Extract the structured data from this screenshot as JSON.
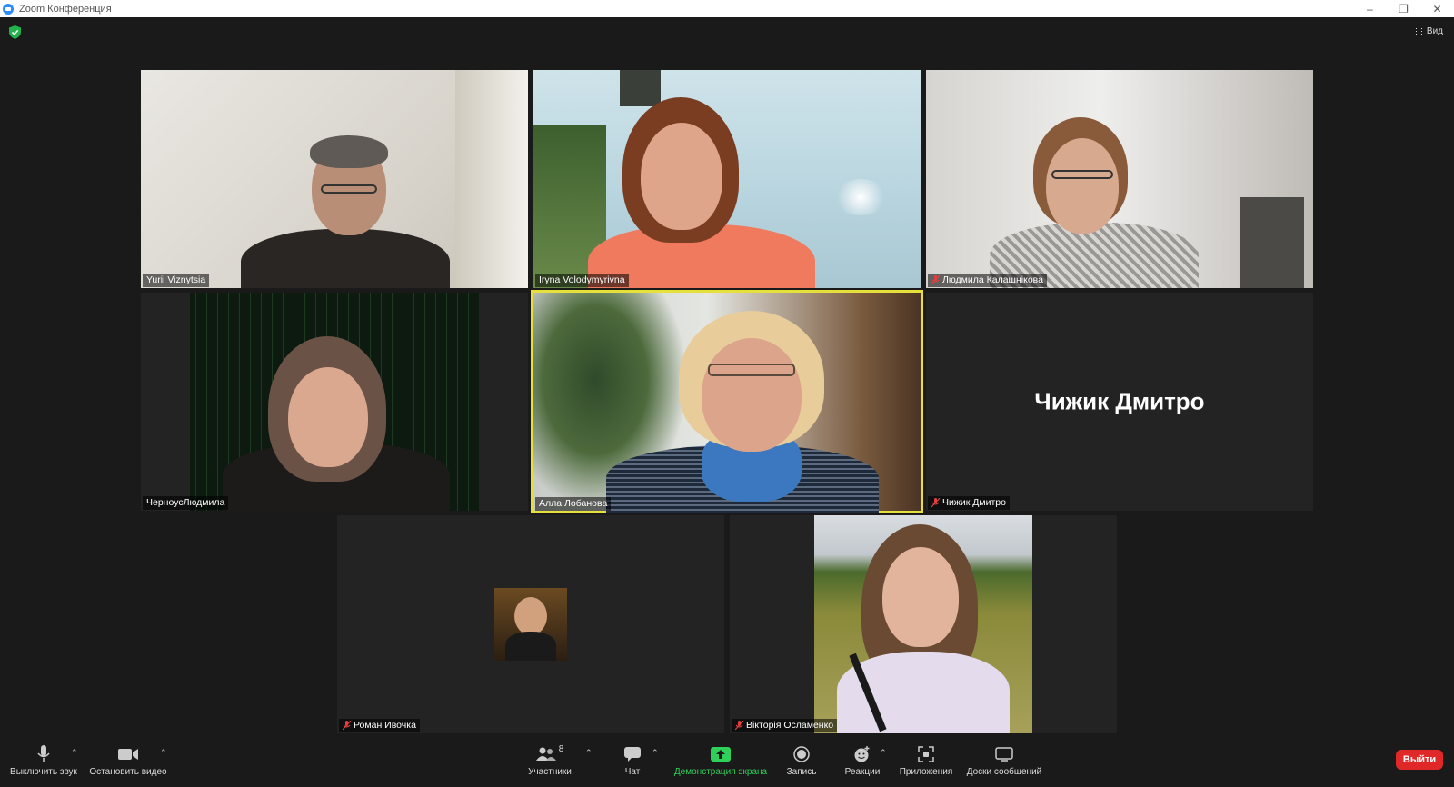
{
  "window": {
    "title": "Zoom Конференция",
    "controls": [
      "minimize",
      "restore",
      "close"
    ]
  },
  "top": {
    "view_label": "Вид"
  },
  "participants": [
    {
      "name": "Yurii Viznytsia",
      "muted": false,
      "video": true
    },
    {
      "name": "Iryna Volodymyrivna",
      "muted": false,
      "video": true
    },
    {
      "name": "Людмила Калашнікова",
      "muted": true,
      "video": true
    },
    {
      "name": "ЧерноусЛюдмила",
      "muted": false,
      "video": true
    },
    {
      "name": "Алла Лобанова",
      "muted": false,
      "video": true,
      "active_speaker": true
    },
    {
      "name": "Чижик Дмитро",
      "muted": true,
      "video": false,
      "display_name": "Чижик Дмитро"
    },
    {
      "name": "Роман Ивочка",
      "muted": true,
      "video": false,
      "avatar": true
    },
    {
      "name": "Вікторія Осламенко",
      "muted": true,
      "video": true
    }
  ],
  "toolbar": {
    "mute_label": "Выключить звук",
    "video_label": "Остановить видео",
    "participants_label": "Участники",
    "participants_count": "8",
    "chat_label": "Чат",
    "share_label": "Демонстрация экрана",
    "record_label": "Запись",
    "reactions_label": "Реакции",
    "apps_label": "Приложения",
    "whiteboard_label": "Доски сообщений",
    "leave_label": "Выйти"
  },
  "colors": {
    "accent_share": "#2fd05a",
    "active_speaker": "#e6e03c",
    "leave": "#e02828",
    "secure_shield": "#23b14d"
  }
}
